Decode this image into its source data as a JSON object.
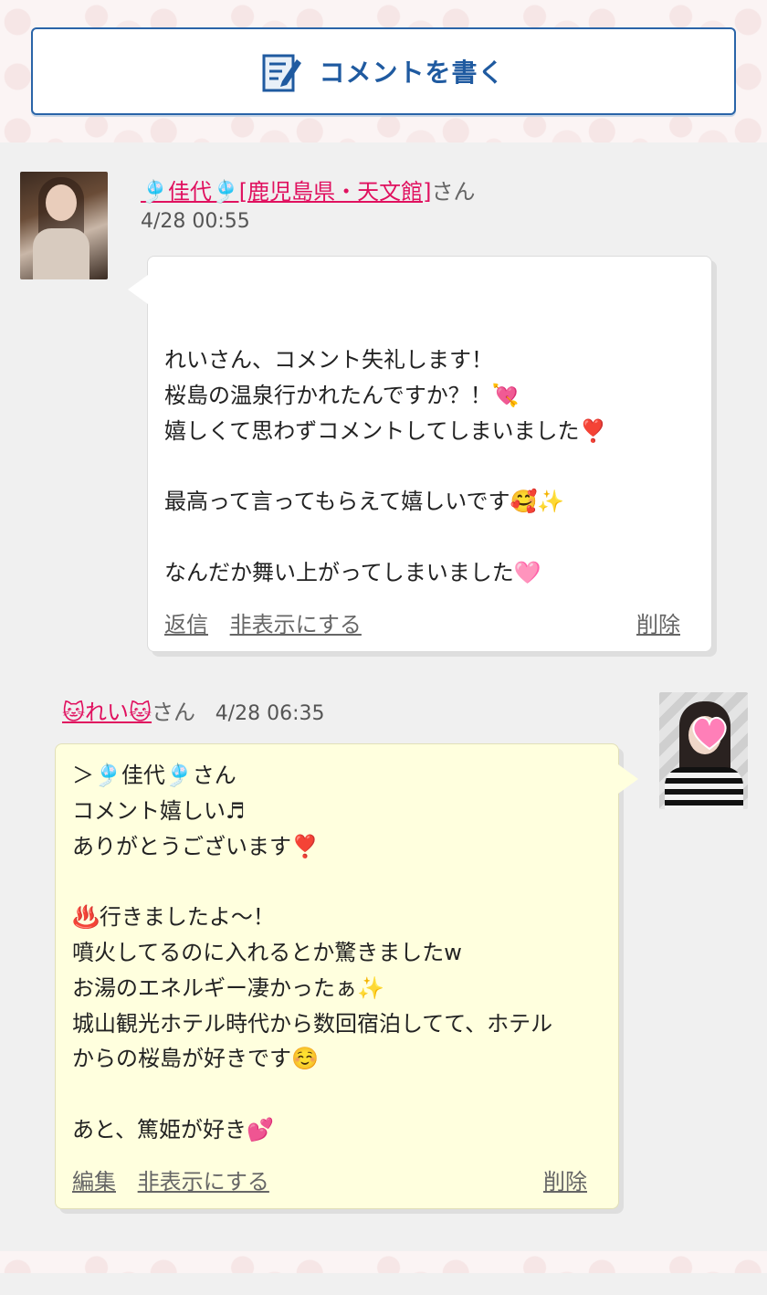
{
  "write_button": {
    "label": "コメントを書く",
    "icon": "compose-icon"
  },
  "comment1": {
    "name": "🎐佳代🎐[鹿児島県・天文館]",
    "suffix": "さん",
    "time": "4/28 00:55",
    "body": "れいさん、コメント失礼します！\n桜島の温泉行かれたんですか？！💘\n嬉しくて思わずコメントしてしまいました❣️\n\n最高って言ってもらえて嬉しいです🥰✨\n\nなんだか舞い上がってしまいました🩷",
    "actions": {
      "reply": "返信",
      "hide": "非表示にする",
      "delete": "削除"
    }
  },
  "comment2": {
    "name": "🐱れい🐱",
    "suffix": "さん",
    "time": "4/28 06:35",
    "body": "＞🎐佳代🎐さん\nコメント嬉しい♬\nありがとうございます❣️\n\n♨️行きましたよ〜！\n噴火してるのに入れるとか驚きましたw\nお湯のエネルギー凄かったぁ✨\n城山観光ホテル時代から数回宿泊してて、ホテル\nからの桜島が好きです☺️\n\nあと、篤姫が好き💕",
    "actions": {
      "edit": "編集",
      "hide": "非表示にする",
      "delete": "削除"
    }
  },
  "colors": {
    "accent_blue": "#1f5aa0",
    "name_pink": "#e0115f",
    "reply_bubble": "#ffffde"
  }
}
